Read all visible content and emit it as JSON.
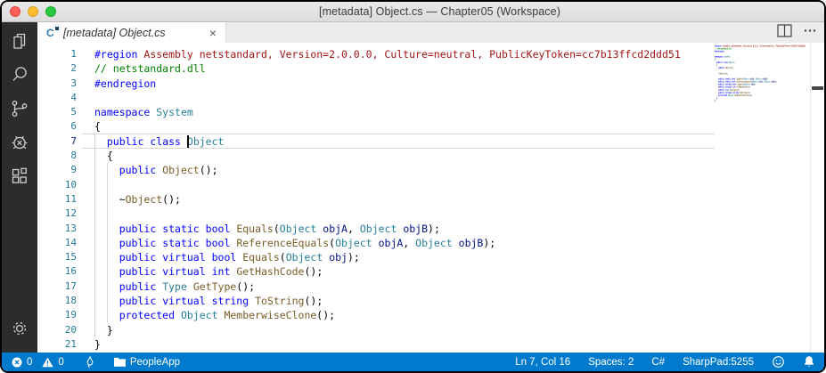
{
  "titlebar": {
    "title": "[metadata] Object.cs — Chapter05 (Workspace)"
  },
  "activity_bar": {
    "items": [
      "explorer",
      "search",
      "source-control",
      "debug",
      "extensions"
    ],
    "bottom": "settings"
  },
  "tab": {
    "label": "[metadata] Object.cs",
    "close": "×",
    "icon_text": "C"
  },
  "editor": {
    "cursor": {
      "line": 7,
      "col": 16
    },
    "token_colors": {
      "kw": "#0000FF",
      "ty": "#267F99",
      "me": "#795E26",
      "pa": "#001080",
      "co": "#008000",
      "pp": "#0000FF",
      "rd": "#A31515",
      "pl": "#000000"
    },
    "lines": [
      {
        "num": 1,
        "tokens": [
          [
            "pp",
            "#region"
          ],
          [
            "rd",
            " Assembly netstandard, Version=2.0.0.0, Culture=neutral, PublicKeyToken=cc7b13ffcd2ddd51"
          ]
        ]
      },
      {
        "num": 2,
        "tokens": [
          [
            "co",
            "// netstandard.dll"
          ]
        ]
      },
      {
        "num": 3,
        "tokens": [
          [
            "pp",
            "#endregion"
          ]
        ]
      },
      {
        "num": 4,
        "tokens": []
      },
      {
        "num": 5,
        "tokens": [
          [
            "kw",
            "namespace"
          ],
          [
            "pl",
            " "
          ],
          [
            "ty",
            "System"
          ]
        ]
      },
      {
        "num": 6,
        "tokens": [
          [
            "pl",
            "{"
          ]
        ]
      },
      {
        "num": 7,
        "tokens": [
          [
            "pl",
            "  "
          ],
          [
            "kw",
            "public"
          ],
          [
            "pl",
            " "
          ],
          [
            "kw",
            "class"
          ],
          [
            "pl",
            " "
          ],
          [
            "ty",
            "Object"
          ]
        ]
      },
      {
        "num": 8,
        "tokens": [
          [
            "pl",
            "  {"
          ]
        ]
      },
      {
        "num": 9,
        "tokens": [
          [
            "pl",
            "    "
          ],
          [
            "kw",
            "public"
          ],
          [
            "pl",
            " "
          ],
          [
            "me",
            "Object"
          ],
          [
            "pl",
            "();"
          ]
        ]
      },
      {
        "num": 10,
        "tokens": []
      },
      {
        "num": 11,
        "tokens": [
          [
            "pl",
            "    ~"
          ],
          [
            "me",
            "Object"
          ],
          [
            "pl",
            "();"
          ]
        ]
      },
      {
        "num": 12,
        "tokens": []
      },
      {
        "num": 13,
        "tokens": [
          [
            "pl",
            "    "
          ],
          [
            "kw",
            "public"
          ],
          [
            "pl",
            " "
          ],
          [
            "kw",
            "static"
          ],
          [
            "pl",
            " "
          ],
          [
            "kw",
            "bool"
          ],
          [
            "pl",
            " "
          ],
          [
            "me",
            "Equals"
          ],
          [
            "pl",
            "("
          ],
          [
            "ty",
            "Object"
          ],
          [
            "pl",
            " "
          ],
          [
            "pa",
            "objA"
          ],
          [
            "pl",
            ", "
          ],
          [
            "ty",
            "Object"
          ],
          [
            "pl",
            " "
          ],
          [
            "pa",
            "objB"
          ],
          [
            "pl",
            ");"
          ]
        ]
      },
      {
        "num": 14,
        "tokens": [
          [
            "pl",
            "    "
          ],
          [
            "kw",
            "public"
          ],
          [
            "pl",
            " "
          ],
          [
            "kw",
            "static"
          ],
          [
            "pl",
            " "
          ],
          [
            "kw",
            "bool"
          ],
          [
            "pl",
            " "
          ],
          [
            "me",
            "ReferenceEquals"
          ],
          [
            "pl",
            "("
          ],
          [
            "ty",
            "Object"
          ],
          [
            "pl",
            " "
          ],
          [
            "pa",
            "objA"
          ],
          [
            "pl",
            ", "
          ],
          [
            "ty",
            "Object"
          ],
          [
            "pl",
            " "
          ],
          [
            "pa",
            "objB"
          ],
          [
            "pl",
            ");"
          ]
        ]
      },
      {
        "num": 15,
        "tokens": [
          [
            "pl",
            "    "
          ],
          [
            "kw",
            "public"
          ],
          [
            "pl",
            " "
          ],
          [
            "kw",
            "virtual"
          ],
          [
            "pl",
            " "
          ],
          [
            "kw",
            "bool"
          ],
          [
            "pl",
            " "
          ],
          [
            "me",
            "Equals"
          ],
          [
            "pl",
            "("
          ],
          [
            "ty",
            "Object"
          ],
          [
            "pl",
            " "
          ],
          [
            "pa",
            "obj"
          ],
          [
            "pl",
            ");"
          ]
        ]
      },
      {
        "num": 16,
        "tokens": [
          [
            "pl",
            "    "
          ],
          [
            "kw",
            "public"
          ],
          [
            "pl",
            " "
          ],
          [
            "kw",
            "virtual"
          ],
          [
            "pl",
            " "
          ],
          [
            "kw",
            "int"
          ],
          [
            "pl",
            " "
          ],
          [
            "me",
            "GetHashCode"
          ],
          [
            "pl",
            "();"
          ]
        ]
      },
      {
        "num": 17,
        "tokens": [
          [
            "pl",
            "    "
          ],
          [
            "kw",
            "public"
          ],
          [
            "pl",
            " "
          ],
          [
            "ty",
            "Type"
          ],
          [
            "pl",
            " "
          ],
          [
            "me",
            "GetType"
          ],
          [
            "pl",
            "();"
          ]
        ]
      },
      {
        "num": 18,
        "tokens": [
          [
            "pl",
            "    "
          ],
          [
            "kw",
            "public"
          ],
          [
            "pl",
            " "
          ],
          [
            "kw",
            "virtual"
          ],
          [
            "pl",
            " "
          ],
          [
            "kw",
            "string"
          ],
          [
            "pl",
            " "
          ],
          [
            "me",
            "ToString"
          ],
          [
            "pl",
            "();"
          ]
        ]
      },
      {
        "num": 19,
        "tokens": [
          [
            "pl",
            "    "
          ],
          [
            "kw",
            "protected"
          ],
          [
            "pl",
            " "
          ],
          [
            "ty",
            "Object"
          ],
          [
            "pl",
            " "
          ],
          [
            "me",
            "MemberwiseClone"
          ],
          [
            "pl",
            "();"
          ]
        ]
      },
      {
        "num": 20,
        "tokens": [
          [
            "pl",
            "  }"
          ]
        ]
      },
      {
        "num": 21,
        "tokens": [
          [
            "pl",
            "}"
          ]
        ]
      }
    ]
  },
  "status_bar": {
    "background": "#007ACC",
    "left": {
      "error_count": "0",
      "warning_count": "0",
      "project": "PeopleApp"
    },
    "right": {
      "line_col": "Ln 7, Col 16",
      "spaces": "Spaces: 2",
      "language": "C#",
      "sharppad": "SharpPad:5255"
    }
  }
}
